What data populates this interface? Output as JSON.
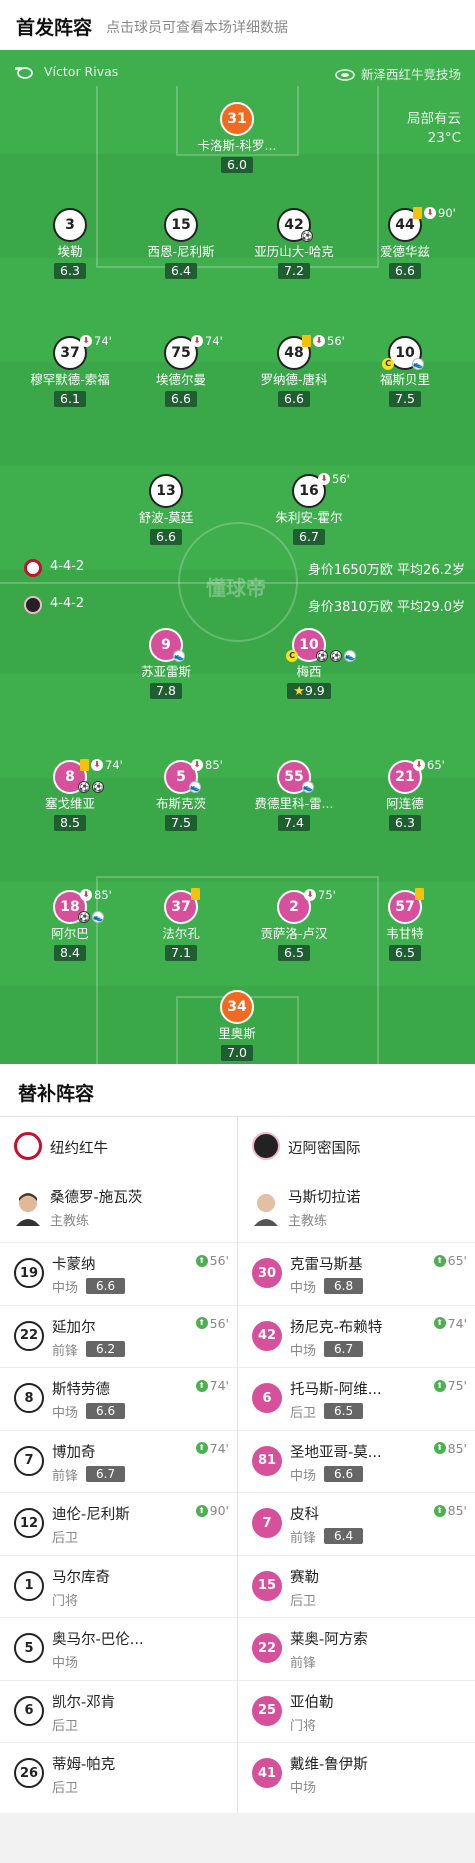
{
  "header": {
    "title": "首发阵容",
    "subtitle": "点击球员可查看本场详细数据"
  },
  "match": {
    "referee": "Víctor Rivas",
    "stadium": "新泽西红牛竞技场",
    "weather": "局部有云",
    "temperature": "23°C"
  },
  "home_bar": {
    "formation": "4-4-2",
    "info": "身价1650万欧 平均26.2岁",
    "color": "#c8102e"
  },
  "away_bar": {
    "formation": "4-4-2",
    "info": "身价3810万欧 平均29.0岁",
    "color": "#222222"
  },
  "watermark": "懂球帝",
  "home_players": [
    {
      "no": "31",
      "name": "卡洛斯-科罗...",
      "rating": "6.0"
    },
    {
      "no": "3",
      "name": "埃勒",
      "rating": "6.3"
    },
    {
      "no": "15",
      "name": "西恩-尼利斯",
      "rating": "6.4"
    },
    {
      "no": "42",
      "name": "亚历山大-哈克",
      "rating": "7.2"
    },
    {
      "no": "44",
      "name": "爱德华兹",
      "rating": "6.6",
      "sub_min": "90'"
    },
    {
      "no": "37",
      "name": "穆罕默德-索福",
      "rating": "6.1",
      "sub_min": "74'"
    },
    {
      "no": "75",
      "name": "埃德尔曼",
      "rating": "6.6",
      "sub_min": "74'"
    },
    {
      "no": "48",
      "name": "罗纳德-唐科",
      "rating": "6.6",
      "sub_min": "56'"
    },
    {
      "no": "10",
      "name": "福斯贝里",
      "rating": "7.5"
    },
    {
      "no": "13",
      "name": "舒波-莫廷",
      "rating": "6.6"
    },
    {
      "no": "16",
      "name": "朱利安-霍尔",
      "rating": "6.7",
      "sub_min": "56'"
    }
  ],
  "away_players": [
    {
      "no": "9",
      "name": "苏亚雷斯",
      "rating": "7.8"
    },
    {
      "no": "10",
      "name": "梅西",
      "rating": "9.9"
    },
    {
      "no": "8",
      "name": "塞戈维亚",
      "rating": "8.5",
      "sub_min": "74'"
    },
    {
      "no": "5",
      "name": "布斯克茨",
      "rating": "7.5",
      "sub_min": "85'"
    },
    {
      "no": "55",
      "name": "费德里科-雷...",
      "rating": "7.4"
    },
    {
      "no": "21",
      "name": "阿连德",
      "rating": "6.3",
      "sub_min": "65'"
    },
    {
      "no": "18",
      "name": "阿尔巴",
      "rating": "8.4",
      "sub_min": "85'"
    },
    {
      "no": "37",
      "name": "法尔孔",
      "rating": "7.1"
    },
    {
      "no": "2",
      "name": "贡萨洛-卢汉",
      "rating": "6.5",
      "sub_min": "75'"
    },
    {
      "no": "57",
      "name": "韦甘特",
      "rating": "6.5"
    },
    {
      "no": "34",
      "name": "里奥斯",
      "rating": "7.0"
    }
  ],
  "bench": {
    "title": "替补阵容",
    "home": {
      "team": "纽约红牛",
      "logo_color": "#c8102e",
      "coach": {
        "name": "桑德罗-施瓦茨",
        "role": "主教练"
      },
      "subs": [
        {
          "no": "19",
          "name": "卡蒙纳",
          "pos": "中场",
          "rating": "6.6",
          "min": "56'"
        },
        {
          "no": "22",
          "name": "延加尔",
          "pos": "前锋",
          "rating": "6.2",
          "min": "56'"
        },
        {
          "no": "8",
          "name": "斯特劳德",
          "pos": "中场",
          "rating": "6.6",
          "min": "74'"
        },
        {
          "no": "7",
          "name": "博加奇",
          "pos": "前锋",
          "rating": "6.7",
          "min": "74'"
        },
        {
          "no": "12",
          "name": "迪伦-尼利斯",
          "pos": "后卫",
          "rating": "",
          "min": "90'"
        },
        {
          "no": "1",
          "name": "马尔库奇",
          "pos": "门将",
          "rating": "",
          "min": ""
        },
        {
          "no": "5",
          "name": "奥马尔-巴伦...",
          "pos": "中场",
          "rating": "",
          "min": ""
        },
        {
          "no": "6",
          "name": "凯尔-邓肯",
          "pos": "后卫",
          "rating": "",
          "min": ""
        },
        {
          "no": "26",
          "name": "蒂姆-帕克",
          "pos": "后卫",
          "rating": "",
          "min": ""
        }
      ]
    },
    "away": {
      "team": "迈阿密国际",
      "logo_color": "#222222",
      "coach": {
        "name": "马斯切拉诺",
        "role": "主教练"
      },
      "subs": [
        {
          "no": "30",
          "name": "克雷马斯基",
          "pos": "中场",
          "rating": "6.8",
          "min": "65'"
        },
        {
          "no": "42",
          "name": "扬尼克-布赖特",
          "pos": "中场",
          "rating": "6.7",
          "min": "74'"
        },
        {
          "no": "6",
          "name": "托马斯-阿维...",
          "pos": "后卫",
          "rating": "6.5",
          "min": "75'"
        },
        {
          "no": "81",
          "name": "圣地亚哥-莫...",
          "pos": "中场",
          "rating": "6.6",
          "min": "85'"
        },
        {
          "no": "7",
          "name": "皮科",
          "pos": "前锋",
          "rating": "6.4",
          "min": "85'"
        },
        {
          "no": "15",
          "name": "赛勒",
          "pos": "后卫",
          "rating": "",
          "min": ""
        },
        {
          "no": "22",
          "name": "莱奥-阿方索",
          "pos": "前锋",
          "rating": "",
          "min": ""
        },
        {
          "no": "25",
          "name": "亚伯勒",
          "pos": "门将",
          "rating": "",
          "min": ""
        },
        {
          "no": "41",
          "name": "戴维-鲁伊斯",
          "pos": "中场",
          "rating": "",
          "min": ""
        }
      ]
    }
  }
}
